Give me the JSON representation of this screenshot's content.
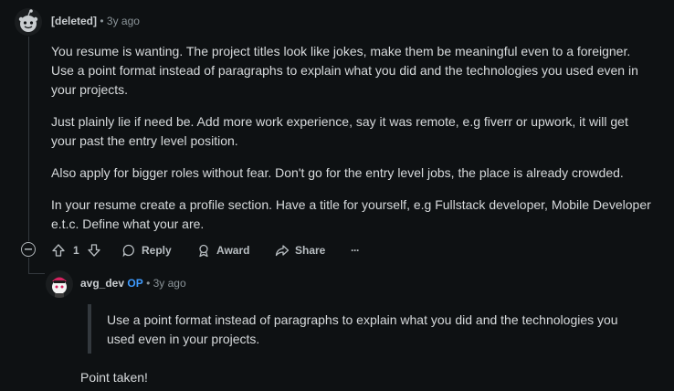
{
  "comment": {
    "author": "[deleted]",
    "time": "3y ago",
    "paragraphs": [
      "You resume is wanting. The project titles look like jokes, make them be meaningful even to a foreigner. Use a point format instead of paragraphs to explain what you did and the technologies you used even in your projects.",
      "Just plainly lie if need be. Add more work experience, say it was remote, e.g fiverr or upwork, it will get your past the entry level position.",
      "Also apply for bigger roles without fear. Don't go for the entry level jobs, the place is already crowded.",
      "In your resume create a profile section. Have a title for yourself, e.g Fullstack developer, Mobile Developer e.t.c. Define what your are."
    ],
    "votes": "1",
    "actions": {
      "reply": "Reply",
      "award": "Award",
      "share": "Share",
      "more": "···"
    }
  },
  "reply": {
    "author": "avg_dev",
    "op_badge": "OP",
    "time": "3y ago",
    "quote": "Use a point format instead of paragraphs to explain what you did and the technologies you used even in your projects.",
    "text": "Point taken!"
  },
  "colors": {
    "background": "#0e1113",
    "op": "#3e9bff",
    "thread_line": "#33393e"
  }
}
